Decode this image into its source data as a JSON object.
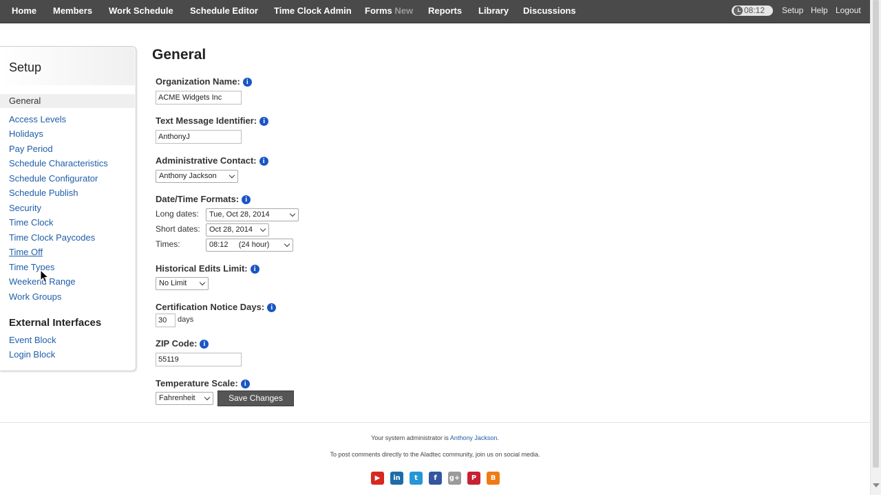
{
  "nav": {
    "items": [
      {
        "label": "Home"
      },
      {
        "label": "Members"
      },
      {
        "label": "Work Schedule"
      },
      {
        "label": "Schedule Editor"
      },
      {
        "label": "Time Clock Admin"
      },
      {
        "label": "Forms",
        "badge": "New"
      },
      {
        "label": "Reports"
      },
      {
        "label": "Library"
      },
      {
        "label": "Discussions"
      }
    ],
    "clock_time": "08:12",
    "right": [
      "Setup",
      "Help",
      "Logout"
    ]
  },
  "sidebar": {
    "title": "Setup",
    "active": "General",
    "items": [
      "Access Levels",
      "Holidays",
      "Pay Period",
      "Schedule Characteristics",
      "Schedule Configurator",
      "Schedule Publish",
      "Security",
      "Time Clock",
      "Time Clock Paycodes",
      "Time Off",
      "Time Types",
      "Weekend Range",
      "Work Groups"
    ],
    "section2_title": "External Interfaces",
    "section2_items": [
      "Event Block",
      "Login Block"
    ]
  },
  "main": {
    "title": "General",
    "org_name_label": "Organization Name:",
    "org_name_value": "ACME Widgets Inc",
    "text_id_label": "Text Message Identifier:",
    "text_id_value": "AnthonyJ",
    "admin_contact_label": "Administrative Contact:",
    "admin_contact_value": "Anthony Jackson",
    "datetime_label": "Date/Time Formats:",
    "long_dates_label": "Long dates:",
    "long_dates_value": "Tue, Oct 28, 2014",
    "short_dates_label": "Short dates:",
    "short_dates_value": "Oct 28, 2014",
    "times_label": "Times:",
    "times_value": "08:12     (24 hour)",
    "hist_edits_label": "Historical Edits Limit:",
    "hist_edits_value": "No Limit",
    "cert_notice_label": "Certification Notice Days:",
    "cert_notice_value": "30",
    "cert_notice_unit": "days",
    "zip_label": "ZIP Code:",
    "zip_value": "55119",
    "temp_label": "Temperature Scale:",
    "temp_value": "Fahrenheit",
    "save_label": "Save Changes",
    "info_glyph": "i"
  },
  "footer": {
    "admin_prefix": "Your system administrator is ",
    "admin_name": "Anthony Jackson",
    "admin_suffix": ".",
    "social_text": "To post comments directly to the Aladtec community, join us on social media.",
    "social_icons": [
      {
        "name": "youtube-icon",
        "glyph": "▶",
        "color": "#d8281f"
      },
      {
        "name": "linkedin-icon",
        "glyph": "in",
        "color": "#1e6ca8"
      },
      {
        "name": "twitter-icon",
        "glyph": "t",
        "color": "#2796d6"
      },
      {
        "name": "facebook-icon",
        "glyph": "f",
        "color": "#3456a0"
      },
      {
        "name": "googleplus-icon",
        "glyph": "g+",
        "color": "#9a9a9a"
      },
      {
        "name": "pinterest-icon",
        "glyph": "P",
        "color": "#c62232"
      },
      {
        "name": "blogger-icon",
        "glyph": "B",
        "color": "#f07a14"
      }
    ]
  }
}
